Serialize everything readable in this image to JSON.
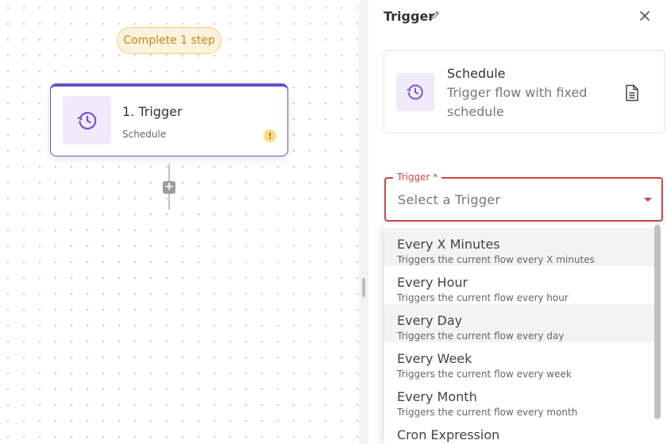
{
  "canvas": {
    "status_pill": "Complete 1 step",
    "node": {
      "title": "1. Trigger",
      "subtitle": "Schedule",
      "icon": "clock-schedule-icon",
      "warning_mark": "!"
    },
    "add_button": "+"
  },
  "panel": {
    "title": "Trigger",
    "edit_icon": "pencil-icon",
    "close_icon": "close-icon",
    "card": {
      "title": "Schedule",
      "description": "Trigger flow with fixed schedule",
      "icon": "clock-schedule-icon",
      "doc_icon": "document-icon"
    },
    "trigger_select": {
      "label": "Trigger *",
      "placeholder": "Select a Trigger",
      "options": [
        {
          "label": "Every X Minutes",
          "description": "Triggers the current flow every X minutes"
        },
        {
          "label": "Every Hour",
          "description": "Triggers the current flow every hour"
        },
        {
          "label": "Every Day",
          "description": "Triggers the current flow every day"
        },
        {
          "label": "Every Week",
          "description": "Triggers the current flow every week"
        },
        {
          "label": "Every Month",
          "description": "Triggers the current flow every month"
        },
        {
          "label": "Cron Expression",
          "description": ""
        }
      ]
    }
  },
  "colors": {
    "accent": "#6a4ec8",
    "error": "#d04545",
    "warning_bg": "#fdf3dc",
    "warning_text": "#c9851a"
  }
}
